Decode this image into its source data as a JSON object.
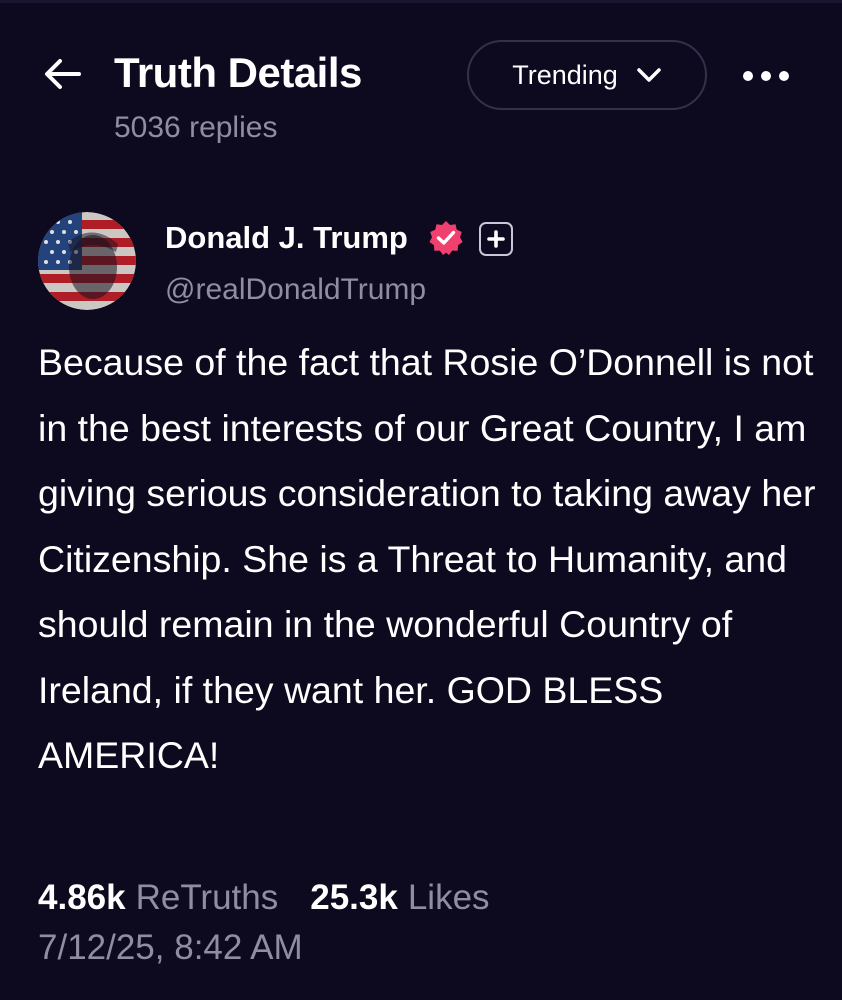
{
  "header": {
    "title": "Truth Details",
    "reply_count": "5036 replies",
    "sort_button": {
      "label": "Trending",
      "icon": "chevron-down-icon"
    },
    "back_icon": "arrow-left-icon",
    "menu_icon": "more-horizontal-icon"
  },
  "post": {
    "author": {
      "display_name": "Donald J. Trump",
      "handle": "@realDonaldTrump",
      "verified_icon": "verified-badge-icon",
      "plus_icon": "plus-badge-icon"
    },
    "body": "Because of the fact that Rosie O’Donnell is not in the best interests of our Great Country, I am giving serious consideration to taking away her Citizenship. She is a Threat to Humanity, and should remain in the wonderful Country of Ireland, if they want her. GOD BLESS AMERICA!",
    "stats": {
      "retruths_count": "4.86k",
      "retruths_label": "ReTruths",
      "likes_count": "25.3k",
      "likes_label": "Likes"
    },
    "timestamp": "7/12/25, 8:42 AM"
  },
  "colors": {
    "background": "#0d0a1f",
    "primary_text": "#ffffff",
    "secondary_text": "#8f8ca3",
    "button_border": "#34304c",
    "verified_badge": "#f0406e"
  }
}
